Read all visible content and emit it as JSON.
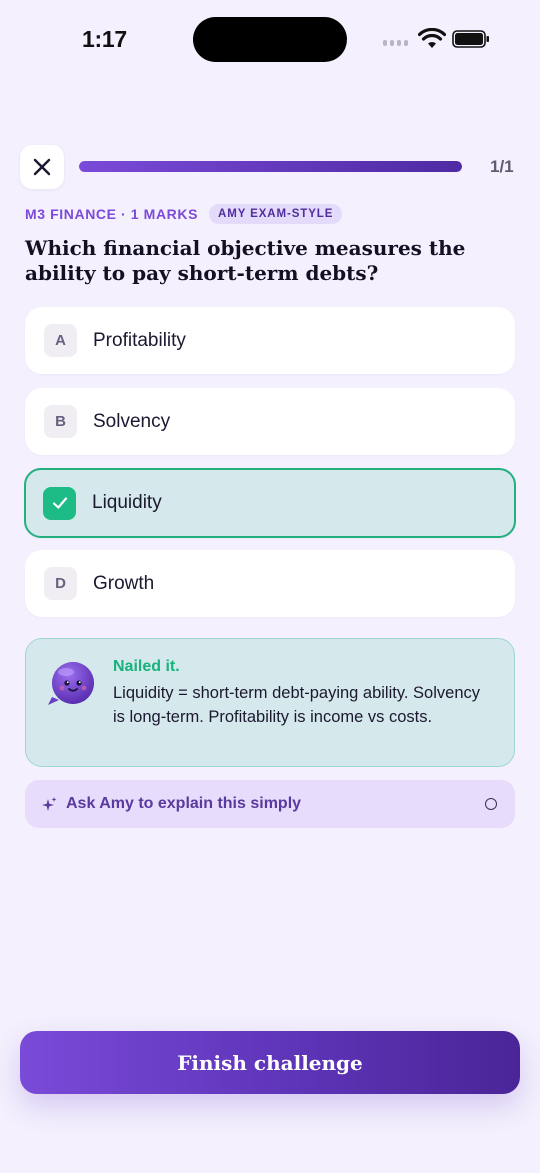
{
  "status_bar": {
    "time": "1:17"
  },
  "progress": {
    "fraction": 1.0,
    "count_label": "1/1"
  },
  "meta": {
    "topic": "M3 FINANCE · 1 MARKS",
    "badge": "AMY EXAM-STYLE"
  },
  "question": {
    "text": "Which financial objective measures the ability to pay short-term debts?"
  },
  "options": [
    {
      "letter": "A",
      "label": "Profitability",
      "selected": false
    },
    {
      "letter": "B",
      "label": "Solvency",
      "selected": false
    },
    {
      "letter": "C",
      "label": "Liquidity",
      "selected": true
    },
    {
      "letter": "D",
      "label": "Growth",
      "selected": false
    }
  ],
  "feedback": {
    "title": "Nailed it.",
    "body": "Liquidity = short-term debt-paying ability. Solvency is long-term. Profitability is income vs costs."
  },
  "ask": {
    "label": "Ask Amy to explain this simply"
  },
  "finish": {
    "label": "Finish challenge"
  },
  "colors": {
    "accent": "#7c4ad9",
    "correct": "#1dbb86",
    "background": "#f4f0fd"
  },
  "icons": {
    "close": "close-icon",
    "check": "check-icon",
    "mascot": "amy-mascot-icon",
    "sparkle": "sparkle-icon",
    "wifi": "wifi-icon",
    "battery": "battery-icon"
  }
}
